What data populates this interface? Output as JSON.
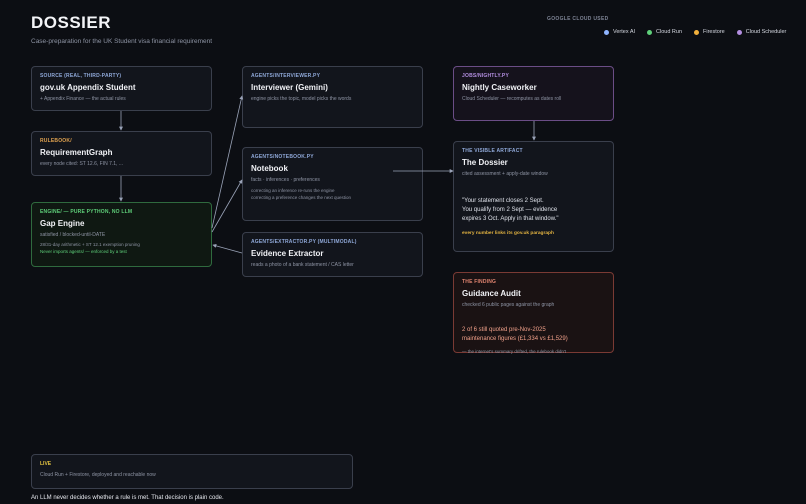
{
  "header": {
    "title": "DOSSIER",
    "subtitle": "Case-preparation for the UK Student visa financial requirement"
  },
  "cloud": {
    "heading": "GOOGLE CLOUD USED",
    "services": [
      {
        "label": "Vertex AI",
        "color": "#8fb4ff"
      },
      {
        "label": "Cloud Run",
        "color": "#5fd07a"
      },
      {
        "label": "Firestore",
        "color": "#f2b03c"
      },
      {
        "label": "Cloud Scheduler",
        "color": "#b38ee0"
      }
    ]
  },
  "cards": {
    "source": {
      "kicker": "SOURCE (REAL, THIRD-PARTY)",
      "title": "gov.uk Appendix Student",
      "desc": "+ Appendix Finance — the actual rules"
    },
    "rulebook": {
      "kicker": "RULEBOOK/",
      "title": "RequirementGraph",
      "desc": "every node cited: ST 12.6, FIN 7.1, ..."
    },
    "engine": {
      "kicker": "ENGINE/ — PURE PYTHON, NO LLM",
      "title": "Gap Engine",
      "desc": "satisfied / blocked-until-DATE",
      "note": "28/31-day arithmetic + ST 12.1 exemption pruning",
      "green": "Never imports agents/ — enforced by a test"
    },
    "interviewer": {
      "kicker": "AGENTS/INTERVIEWER.PY",
      "title": "Interviewer (Gemini)",
      "desc": "engine picks the topic, model picks the words"
    },
    "notebook": {
      "kicker": "AGENTS/NOTEBOOK.PY",
      "title": "Notebook",
      "desc": "facts · inferences · preferences",
      "note1": "correcting an inference re-runs the engine",
      "note2": "correcting a preference changes the next question"
    },
    "extractor": {
      "kicker": "AGENTS/EXTRACTOR.PY (MULTIMODAL)",
      "title": "Evidence Extractor",
      "desc": "reads a photo of a bank statement / CAS letter"
    },
    "nightly": {
      "kicker": "JOBS/NIGHTLY.PY",
      "title": "Nightly Caseworker",
      "desc": "Cloud Scheduler — recomputes as dates roll"
    },
    "dossier": {
      "kicker": "THE VISIBLE ARTIFACT",
      "title": "The Dossier",
      "desc": "cited assessment + apply-date window",
      "quote1": "\"Your statement closes 2 Sept.",
      "quote2": "You qualify from 2 Sept — evidence",
      "quote3": "expires 3 Oct. Apply in that window.\"",
      "amber": "every number links its gov.uk paragraph"
    },
    "finding": {
      "kicker": "THE FINDING",
      "title": "Guidance Audit",
      "desc": "checked 6 public pages against the graph",
      "line1": "2 of 6 still quoted pre-Nov-2025",
      "line2": "maintenance figures (£1,334 vs £1,529)",
      "note": "— the internet's summary drifted, the rulebook didn't"
    },
    "live": {
      "kicker": "LIVE",
      "desc": "Cloud Run + Firestore, deployed and reachable now"
    }
  },
  "footer": "An LLM never decides whether a rule is met. That decision is plain code."
}
